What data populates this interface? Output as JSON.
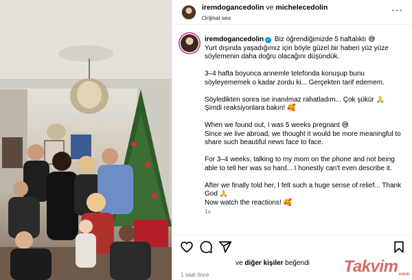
{
  "header": {
    "user1": "iremdogancedolin",
    "conjunction": "ve",
    "user2": "michelecedolin",
    "audio": "Orijinal ses",
    "more_icon": "more-horizontal-icon"
  },
  "caption": {
    "username": "iremdogancedolin",
    "lines": [
      "Biz öğrendiğimizde 5 haftalıktı 😅",
      "Yurt dışında yaşadığımız için böyle güzel bir haberi yüz yüze söylemenin daha doğru olacağını düşündük.",
      "",
      "3–4 hafta boyunca annemle telefonda konuşup bunu söyleyememek o kadar zordu ki... Gerçekten tarif edemem.",
      "",
      "Söyledikten sonra ise inanılmaz rahatladım... Çok şükür 🙏",
      "Şimdi reaksiyonlara bakın! 🥰",
      "",
      "When we found out, I was 5 weeks pregnant 😅",
      "Since we live abroad, we thought it would be more meaningful to share such beautiful news face to face.",
      "",
      "For 3–4 weeks, talking to my mom on the phone and not being able to tell her was so hard... I honestly can't even describe it.",
      "",
      "After we finally told her, I felt such a huge sense of relief... Thank God 🙏",
      "Now watch the reactions! 🥰"
    ],
    "time": "1s"
  },
  "actions": {
    "like_icon": "heart-icon",
    "comment_icon": "comment-icon",
    "share_icon": "share-icon",
    "save_icon": "bookmark-icon"
  },
  "likes": {
    "prefix": "ve",
    "others": "diğer kişiler",
    "suffix": "beğendi"
  },
  "posted": "1 saat önce",
  "watermark": {
    "brand": "Takvim",
    "domain": ".com.tr"
  },
  "colors": {
    "verified": "#0095f6",
    "ring": "#d62976",
    "muted": "#737373",
    "border": "#efefef"
  }
}
